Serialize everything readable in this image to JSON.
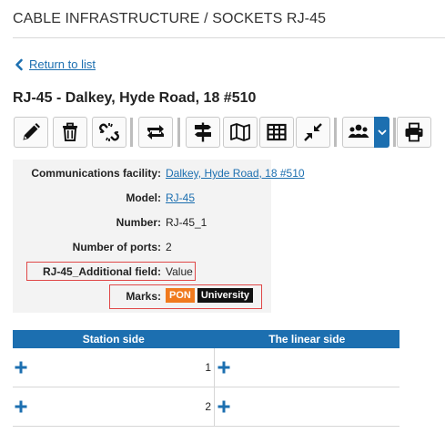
{
  "header": {
    "breadcrumb": "CABLE INFRASTRUCTURE / SOCKETS RJ-45",
    "back_link": "Return to list"
  },
  "object": {
    "title": "RJ-45 - Dalkey, Hyde Road, 18 #510"
  },
  "toolbar": {
    "buttons": [
      "edit-icon",
      "trash-icon",
      "unlink-icon",
      "retweet-icon",
      "signpost-icon",
      "map-icon",
      "table-icon",
      "compress-icon",
      "users-icon",
      "print-icon"
    ],
    "accent": "#1c6fb0"
  },
  "properties": {
    "communications_facility": {
      "label": "Communications facility:",
      "value": "Dalkey, Hyde Road, 18 #510"
    },
    "model": {
      "label": "Model:",
      "value": "RJ-45"
    },
    "number": {
      "label": "Number:",
      "value": "RJ-45_1"
    },
    "ports": {
      "label": "Number of ports:",
      "value": "2"
    },
    "additional_field": {
      "label": "RJ-45_Additional field:",
      "value": "Value"
    },
    "marks": {
      "label": "Marks:",
      "items": [
        {
          "text": "PON",
          "color": "#f07a1e"
        },
        {
          "text": "University",
          "color": "#111111"
        }
      ]
    }
  },
  "ports_table": {
    "headers": {
      "station": "Station side",
      "linear": "The linear side"
    },
    "rows": [
      {
        "number": "1"
      },
      {
        "number": "2"
      }
    ]
  }
}
